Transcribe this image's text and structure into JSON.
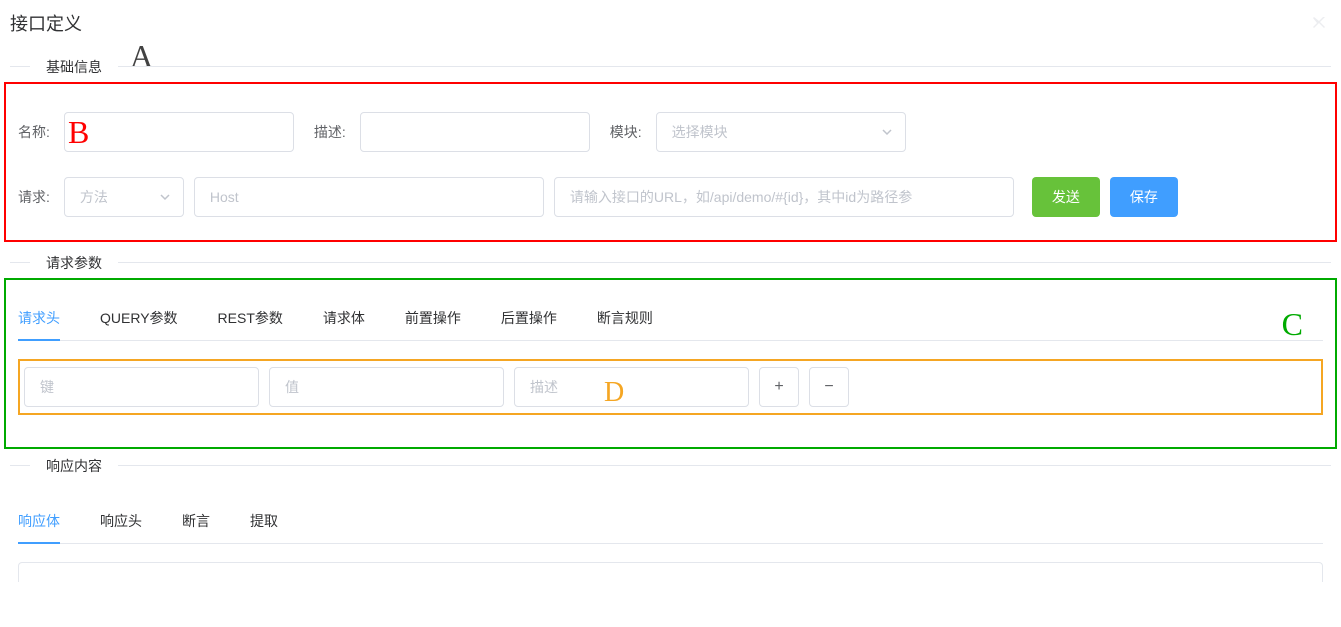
{
  "header": {
    "title": "接口定义"
  },
  "annotations": {
    "A": "A",
    "B": "B",
    "C": "C",
    "D": "D"
  },
  "basic_info": {
    "legend": "基础信息",
    "name_label": "名称:",
    "desc_label": "描述:",
    "module_label": "模块:",
    "module_placeholder": "选择模块",
    "request_label": "请求:",
    "method_placeholder": "方法",
    "host_placeholder": "Host",
    "url_placeholder": "请输入接口的URL，如/api/demo/#{id}，其中id为路径参",
    "send_btn": "发送",
    "save_btn": "保存"
  },
  "request_params": {
    "legend": "请求参数",
    "tabs": [
      "请求头",
      "QUERY参数",
      "REST参数",
      "请求体",
      "前置操作",
      "后置操作",
      "断言规则"
    ],
    "active_tab_index": 0,
    "key_placeholder": "键",
    "value_placeholder": "值",
    "desc_placeholder": "描述"
  },
  "response": {
    "legend": "响应内容",
    "tabs": [
      "响应体",
      "响应头",
      "断言",
      "提取"
    ],
    "active_tab_index": 0
  }
}
